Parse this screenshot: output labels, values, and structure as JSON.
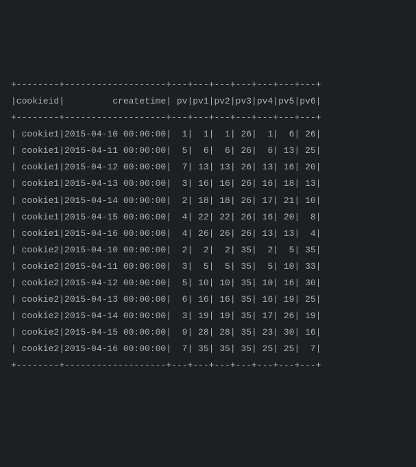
{
  "chart_data": {
    "type": "table",
    "columns": [
      "cookieid",
      "createtime",
      "pv",
      "pv1",
      "pv2",
      "pv3",
      "pv4",
      "pv5",
      "pv6"
    ],
    "rows": [
      [
        "cookie1",
        "2015-04-10 00:00:00",
        1,
        1,
        1,
        26,
        1,
        6,
        26
      ],
      [
        "cookie1",
        "2015-04-11 00:00:00",
        5,
        6,
        6,
        26,
        6,
        13,
        25
      ],
      [
        "cookie1",
        "2015-04-12 00:00:00",
        7,
        13,
        13,
        26,
        13,
        16,
        20
      ],
      [
        "cookie1",
        "2015-04-13 00:00:00",
        3,
        16,
        16,
        26,
        16,
        18,
        13
      ],
      [
        "cookie1",
        "2015-04-14 00:00:00",
        2,
        18,
        18,
        26,
        17,
        21,
        10
      ],
      [
        "cookie1",
        "2015-04-15 00:00:00",
        4,
        22,
        22,
        26,
        16,
        20,
        8
      ],
      [
        "cookie1",
        "2015-04-16 00:00:00",
        4,
        26,
        26,
        26,
        13,
        13,
        4
      ],
      [
        "cookie2",
        "2015-04-10 00:00:00",
        2,
        2,
        2,
        35,
        2,
        5,
        35
      ],
      [
        "cookie2",
        "2015-04-11 00:00:00",
        3,
        5,
        5,
        35,
        5,
        10,
        33
      ],
      [
        "cookie2",
        "2015-04-12 00:00:00",
        5,
        10,
        10,
        35,
        10,
        16,
        30
      ],
      [
        "cookie2",
        "2015-04-13 00:00:00",
        6,
        16,
        16,
        35,
        16,
        19,
        25
      ],
      [
        "cookie2",
        "2015-04-14 00:00:00",
        3,
        19,
        19,
        35,
        17,
        26,
        19
      ],
      [
        "cookie2",
        "2015-04-15 00:00:00",
        9,
        28,
        28,
        35,
        23,
        30,
        16
      ],
      [
        "cookie2",
        "2015-04-16 00:00:00",
        7,
        35,
        35,
        35,
        25,
        25,
        7
      ]
    ],
    "widths": [
      8,
      19,
      3,
      3,
      3,
      3,
      3,
      3,
      3
    ]
  }
}
